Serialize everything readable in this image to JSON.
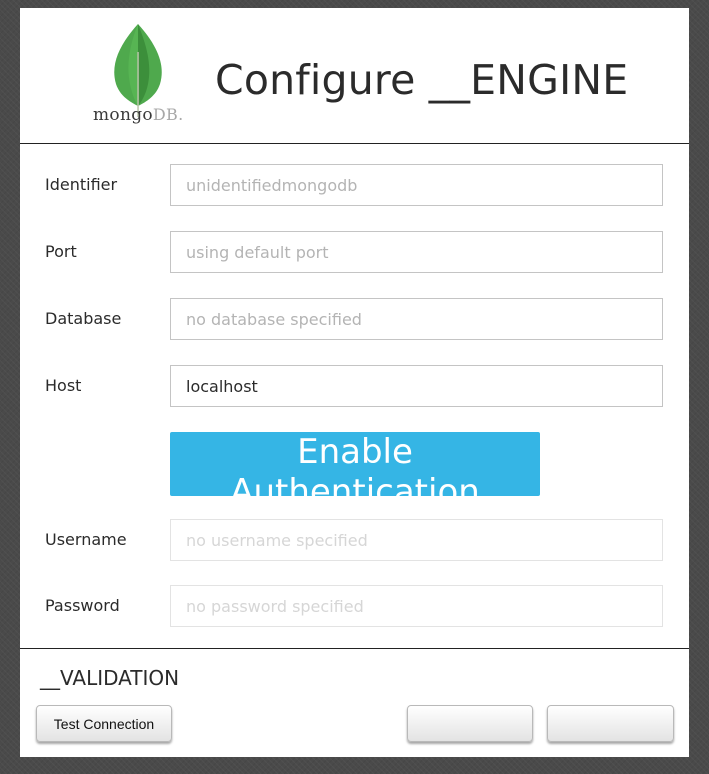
{
  "header": {
    "title": "Configure __ENGINE",
    "logo_text_main": "mongo",
    "logo_text_suffix": "DB."
  },
  "form": {
    "identifier": {
      "label": "Identifier",
      "placeholder": "unidentifiedmongodb",
      "value": ""
    },
    "port": {
      "label": "Port",
      "placeholder": "using default port",
      "value": ""
    },
    "database": {
      "label": "Database",
      "placeholder": "no database specified",
      "value": ""
    },
    "host": {
      "label": "Host",
      "placeholder": "",
      "value": "localhost"
    },
    "auth_button": "Enable Authentication",
    "username": {
      "label": "Username",
      "placeholder": "no username specified",
      "value": ""
    },
    "password": {
      "label": "Password",
      "placeholder": "no password specified",
      "value": ""
    }
  },
  "footer": {
    "validation_label": "__VALIDATION",
    "test_connection": "Test Connection",
    "button2": "",
    "button3": ""
  },
  "colors": {
    "accent": "#35b5e5",
    "leaf_green": "#4fa94d",
    "background": "#4a4a4a"
  },
  "icons": {
    "logo": "mongodb-leaf-icon"
  }
}
